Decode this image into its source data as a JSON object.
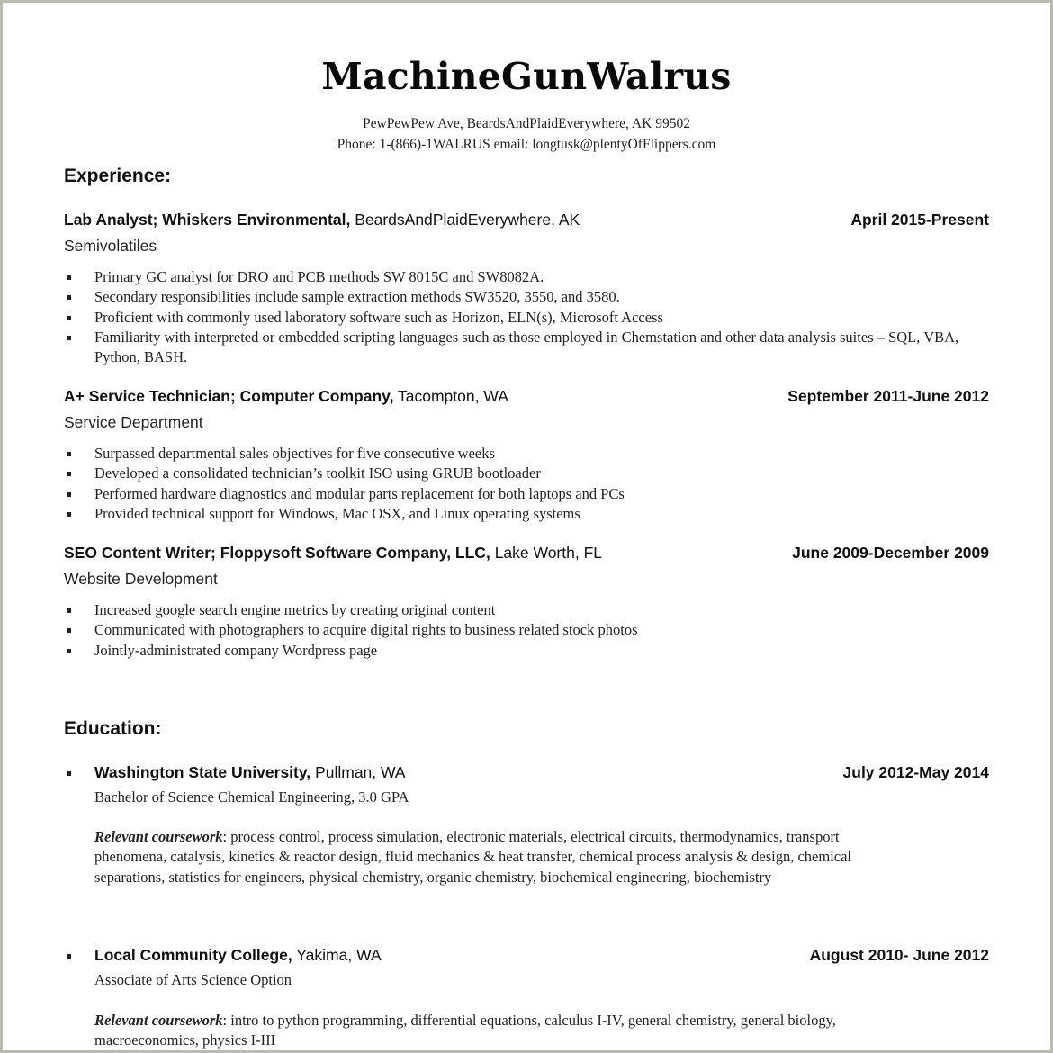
{
  "header": {
    "name": "MachineGunWalrus",
    "address": "PewPewPew Ave, BeardsAndPlaidEverywhere, AK 99502",
    "phone_email": "Phone: 1-(866)-1WALRUS  email: longtusk@plentyOfFlippers.com"
  },
  "experience": {
    "title": "Experience:",
    "jobs": [
      {
        "role_company": "Lab Analyst; Whiskers Environmental,",
        "location": "BeardsAndPlaidEverywhere, AK",
        "dates": "April 2015-Present",
        "department": "Semivolatiles",
        "bullets": [
          "Primary GC analyst for DRO and PCB methods SW 8015C and SW8082A.",
          "Secondary responsibilities include sample extraction methods SW3520, 3550, and 3580.",
          "Proficient with commonly used laboratory software such as Horizon, ELN(s), Microsoft Access",
          "Familiarity with interpreted or embedded scripting languages such as those employed in Chemstation and other data analysis suites – SQL, VBA, Python, BASH."
        ]
      },
      {
        "role_company": "A+ Service Technician; Computer Company,",
        "location": "Tacompton, WA",
        "dates": "September 2011-June 2012",
        "department": "Service Department",
        "bullets": [
          "Surpassed departmental sales objectives for five consecutive weeks",
          "Developed a consolidated technician’s toolkit ISO using GRUB bootloader",
          "Performed hardware diagnostics and modular parts replacement for both laptops and PCs",
          "Provided technical support for Windows, Mac OSX, and Linux operating systems"
        ]
      },
      {
        "role_company": "SEO Content Writer; Floppysoft Software Company, LLC,",
        "location": "Lake Worth, FL",
        "dates": "June 2009-December 2009",
        "department": "Website Development",
        "bullets": [
          "Increased google search engine metrics by creating original content",
          "Communicated with photographers to acquire digital rights to business related stock photos",
          "Jointly-administrated company Wordpress page"
        ]
      }
    ]
  },
  "education": {
    "title": "Education:",
    "schools": [
      {
        "school": "Washington State University,",
        "location": "Pullman, WA",
        "dates": "July 2012-May 2014",
        "degree": "Bachelor of Science Chemical Engineering,  3.0 GPA",
        "coursework_label": "Relevant coursework",
        "coursework": ": process control, process simulation, electronic materials, electrical circuits, thermodynamics, transport phenomena, catalysis, kinetics & reactor design, fluid mechanics & heat transfer, chemical process analysis & design, chemical separations, statistics for engineers, physical chemistry, organic chemistry, biochemical engineering, biochemistry"
      },
      {
        "school": "Local Community College,",
        "location": "Yakima, WA",
        "dates": "August 2010- June 2012",
        "degree": "Associate of Arts Science Option",
        "coursework_label": "Relevant coursework",
        "coursework": ": intro to python programming, differential equations, calculus I-IV, general chemistry, general biology, macroeconomics, physics I-III"
      }
    ]
  }
}
